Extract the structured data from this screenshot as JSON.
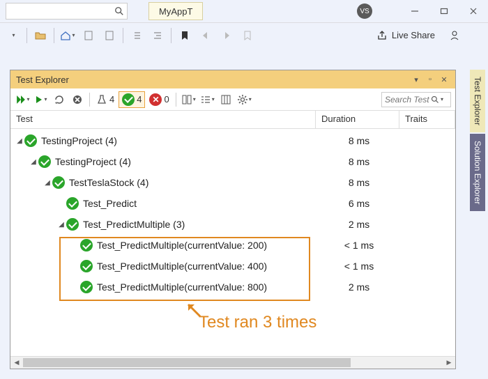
{
  "titlebar": {
    "tab_label": "MyAppT",
    "avatar": "VS"
  },
  "liveshare_label": "Live Share",
  "side_tabs": {
    "test_explorer": "Test Explorer",
    "solution_explorer": "Solution Explorer"
  },
  "panel": {
    "title": "Test Explorer"
  },
  "test_toolbar": {
    "flask_count": "4",
    "pass_count": "4",
    "fail_count": "0",
    "search_placeholder": "Search Test"
  },
  "headers": {
    "test": "Test",
    "duration": "Duration",
    "traits": "Traits"
  },
  "rows": [
    {
      "pad": 0,
      "arrow": true,
      "name": "TestingProject  (4)",
      "dur": "8 ms"
    },
    {
      "pad": 1,
      "arrow": true,
      "name": "TestingProject  (4)",
      "dur": "8 ms"
    },
    {
      "pad": 2,
      "arrow": true,
      "name": "TestTeslaStock  (4)",
      "dur": "8 ms"
    },
    {
      "pad": 3,
      "arrow": false,
      "name": "Test_Predict",
      "dur": "6 ms"
    },
    {
      "pad": 3,
      "arrow": true,
      "name": "Test_PredictMultiple  (3)",
      "dur": "2 ms"
    },
    {
      "pad": 4,
      "arrow": false,
      "name": "Test_PredictMultiple(currentValue: 200)",
      "dur": "< 1 ms"
    },
    {
      "pad": 4,
      "arrow": false,
      "name": "Test_PredictMultiple(currentValue: 400)",
      "dur": "< 1 ms"
    },
    {
      "pad": 4,
      "arrow": false,
      "name": "Test_PredictMultiple(currentValue: 800)",
      "dur": "2 ms"
    }
  ],
  "annotation": "Test ran 3 times"
}
